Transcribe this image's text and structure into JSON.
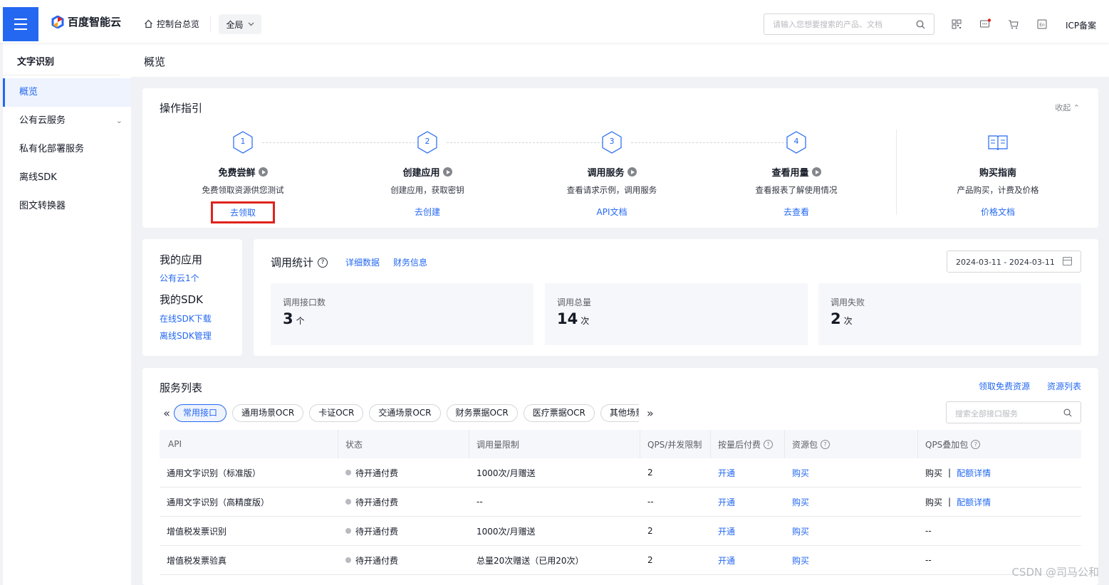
{
  "header": {
    "brand": "百度智能云",
    "console_label": "控制台总览",
    "region": "全局",
    "search_placeholder": "请输入您想要搜索的产品、文档",
    "icp_label": "ICP备案",
    "colors": {
      "primary": "#2468f2",
      "highlight": "#e0231c"
    }
  },
  "sidebar": {
    "title": "文字识别",
    "items": [
      {
        "label": "概览"
      },
      {
        "label": "公有云服务"
      },
      {
        "label": "私有化部署服务"
      },
      {
        "label": "离线SDK"
      },
      {
        "label": "图文转换器"
      }
    ]
  },
  "page": {
    "title": "概览"
  },
  "guide": {
    "title": "操作指引",
    "collapse_label": "收起",
    "steps": [
      {
        "num": "1",
        "name": "免费尝鲜",
        "desc": "免费领取资源供您测试",
        "link": "去领取"
      },
      {
        "num": "2",
        "name": "创建应用",
        "desc": "创建应用，获取密钥",
        "link": "去创建"
      },
      {
        "num": "3",
        "name": "调用服务",
        "desc": "查看请求示例，调用服务",
        "link": "API文档"
      },
      {
        "num": "4",
        "name": "查看用量",
        "desc": "查看报表了解使用情况",
        "link": "去查看"
      }
    ],
    "purchase": {
      "name": "购买指南",
      "desc": "产品购买，计费及价格",
      "link": "价格文档"
    }
  },
  "my_app": {
    "app_title": "我的应用",
    "app_link": "公有云1个",
    "sdk_title": "我的SDK",
    "sdk_download": "在线SDK下载",
    "sdk_manage": "离线SDK管理"
  },
  "stats": {
    "title": "调用统计",
    "detail_link": "详细数据",
    "finance_link": "财务信息",
    "date_range": "2024-03-11 - 2024-03-11",
    "boxes": [
      {
        "label": "调用接口数",
        "value": "3",
        "unit": "个"
      },
      {
        "label": "调用总量",
        "value": "14",
        "unit": "次"
      },
      {
        "label": "调用失败",
        "value": "2",
        "unit": "次"
      }
    ]
  },
  "services": {
    "title": "服务列表",
    "free_link": "领取免费资源",
    "resource_link": "资源列表",
    "tabs": [
      "常用接口",
      "通用场景OCR",
      "卡证OCR",
      "交通场景OCR",
      "财务票据OCR",
      "医疗票据OCR",
      "其他场景"
    ],
    "search_placeholder": "搜索全部接口服务",
    "columns": [
      "API",
      "状态",
      "调用量限制",
      "QPS/并发限制",
      "按量后付费",
      "资源包",
      "QPS叠加包"
    ],
    "rows": [
      {
        "api": "通用文字识别（标准版）",
        "status": "待开通付费",
        "limit": "1000次/月赠送",
        "qps": "2",
        "postpaid": "开通",
        "pack": "购买",
        "qps_buy": "购买",
        "qps_detail": "配额详情"
      },
      {
        "api": "通用文字识别（高精度版）",
        "status": "待开通付费",
        "limit": "--",
        "qps": "--",
        "postpaid": "开通",
        "pack": "购买",
        "qps_buy": "购买",
        "qps_detail": "配额详情"
      },
      {
        "api": "增值税发票识别",
        "status": "待开通付费",
        "limit": "1000次/月赠送",
        "qps": "2",
        "postpaid": "开通",
        "pack": "购买",
        "qps_empty": "--"
      },
      {
        "api": "增值税发票验真",
        "status": "待开通付费",
        "limit": "总量20次赠送（已用20次）",
        "qps": "2",
        "postpaid": "开通",
        "pack": "购买",
        "qps_empty": "--"
      }
    ]
  },
  "watermark": "CSDN @司马公和"
}
